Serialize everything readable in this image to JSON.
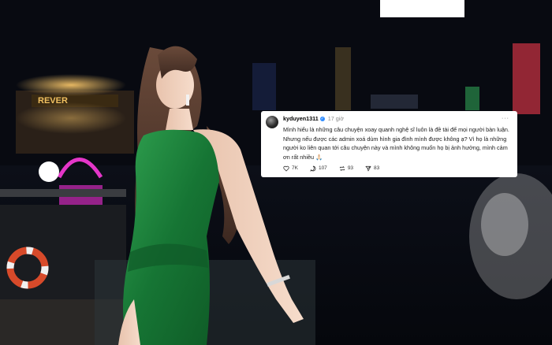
{
  "post": {
    "username": "kyduyen1311",
    "time": "17 giờ",
    "more_label": "···",
    "text": "Mình hiểu là những câu chuyện xoay quanh nghệ sĩ luôn là đề tài để mọi người bàn luận. Nhưng nếu được các admin xoá dùm hình gia đình mình được không ạ? Vì họ là những người ko liên quan tới câu chuyện này và mình không muốn họ bị ảnh hưởng, mình cảm ơn rất nhiều 🙏🏻",
    "likes": "7K",
    "comments": "107",
    "reposts": "93",
    "shares": "83",
    "icons": [
      "heart-icon",
      "comment-icon",
      "repost-icon",
      "share-icon"
    ],
    "accent_verified": "#2f8cff"
  },
  "background": {
    "venue_sign": "REVER",
    "colors": {
      "sky": "#070910",
      "dress": "#1f8a3c",
      "neon_pink": "#e436c8",
      "lights": "#f2b94b"
    }
  }
}
